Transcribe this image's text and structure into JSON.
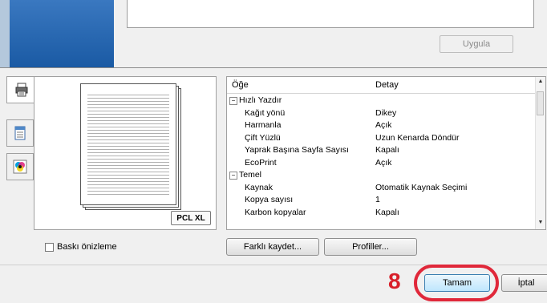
{
  "top": {
    "apply_label": "Uygula"
  },
  "preview": {
    "badge": "PCL XL"
  },
  "properties": {
    "header": {
      "item": "Öğe",
      "detail": "Detay"
    },
    "rows": [
      {
        "key": "Hızlı Yazdır",
        "value": "",
        "group": true,
        "sign": "−"
      },
      {
        "key": "Kağıt yönü",
        "value": "Dikey"
      },
      {
        "key": "Harmanla",
        "value": "Açık"
      },
      {
        "key": "Çift Yüzlü",
        "value": "Uzun Kenarda Döndür"
      },
      {
        "key": "Yaprak Başına Sayfa Sayısı",
        "value": "Kapalı"
      },
      {
        "key": "EcoPrint",
        "value": "Açık"
      },
      {
        "key": "Temel",
        "value": "",
        "group": true,
        "sign": "−"
      },
      {
        "key": "Kaynak",
        "value": "Otomatik Kaynak Seçimi"
      },
      {
        "key": "Kopya sayısı",
        "value": "1"
      },
      {
        "key": "Karbon kopyalar",
        "value": "Kapalı"
      }
    ]
  },
  "options": {
    "preview_checkbox_label": "Baskı önizleme",
    "save_as_label": "Farklı kaydet...",
    "profiles_label": "Profiller..."
  },
  "footer": {
    "step_number": "8",
    "ok_label": "Tamam",
    "cancel_label": "İptal"
  },
  "colors": {
    "highlight": "#e0283a",
    "step_number": "#d8202a"
  }
}
